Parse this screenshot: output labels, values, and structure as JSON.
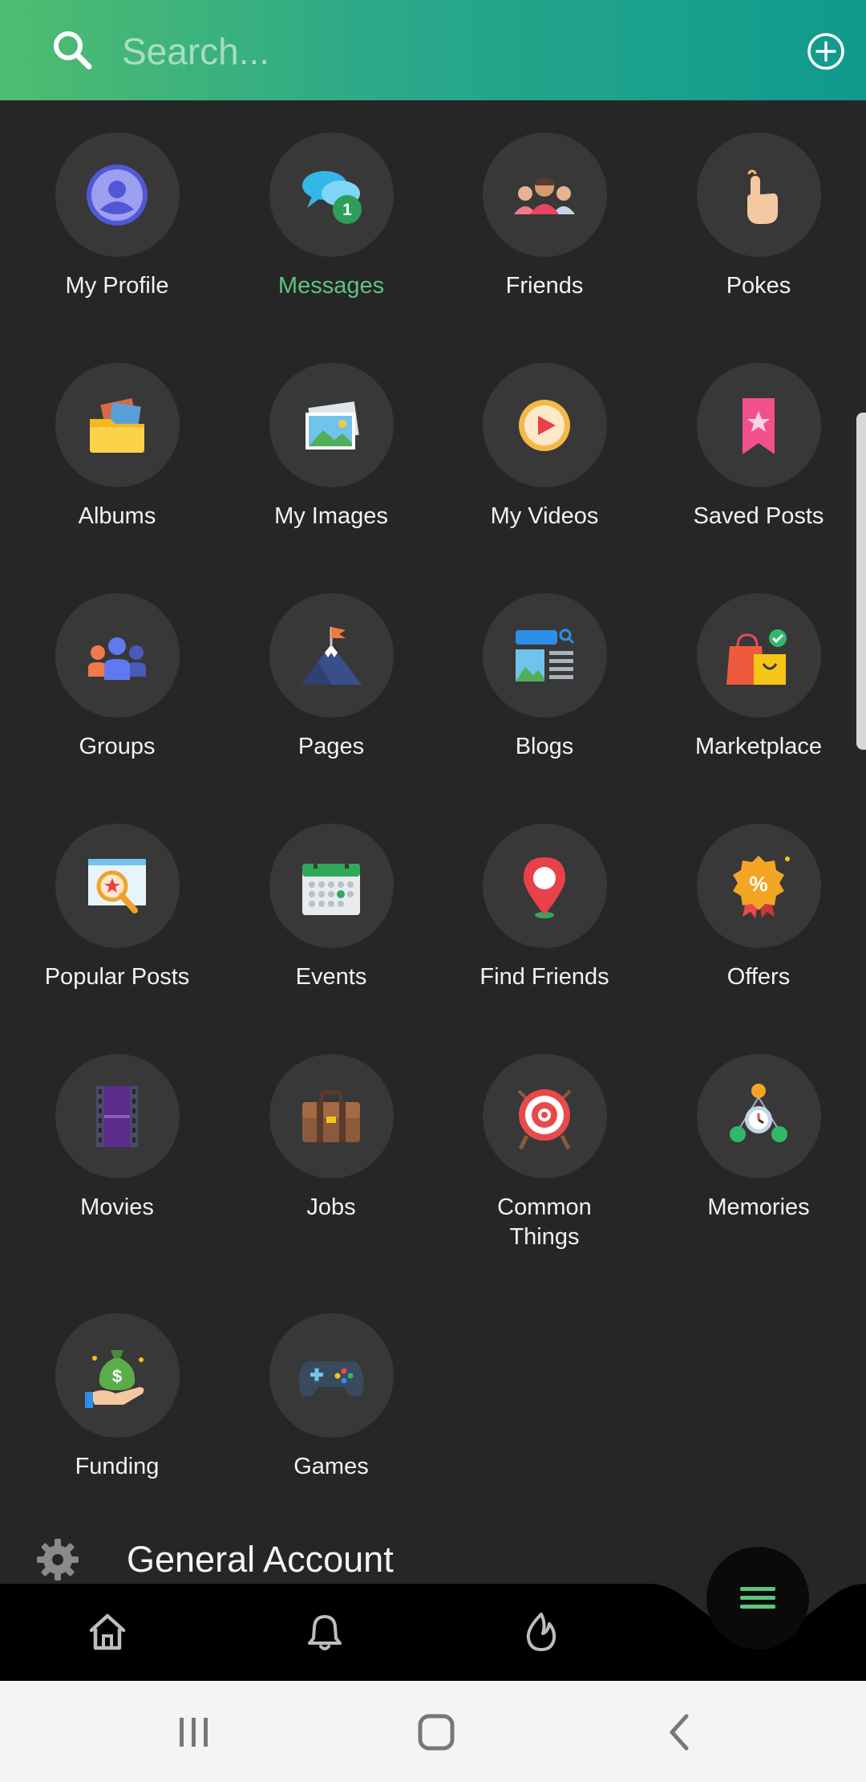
{
  "search": {
    "placeholder": "Search..."
  },
  "grid": [
    {
      "label": "My Profile",
      "icon": "profile-icon"
    },
    {
      "label": "Messages",
      "icon": "messages-icon",
      "badge": "1",
      "active": true
    },
    {
      "label": "Friends",
      "icon": "friends-icon"
    },
    {
      "label": "Pokes",
      "icon": "poke-hand-icon"
    },
    {
      "label": "Albums",
      "icon": "album-folder-icon"
    },
    {
      "label": "My Images",
      "icon": "images-icon"
    },
    {
      "label": "My Videos",
      "icon": "video-play-icon"
    },
    {
      "label": "Saved Posts",
      "icon": "bookmark-icon"
    },
    {
      "label": "Groups",
      "icon": "groups-icon"
    },
    {
      "label": "Pages",
      "icon": "flag-mountain-icon"
    },
    {
      "label": "Blogs",
      "icon": "blog-icon"
    },
    {
      "label": "Marketplace",
      "icon": "shopping-bag-icon"
    },
    {
      "label": "Popular Posts",
      "icon": "popular-search-icon"
    },
    {
      "label": "Events",
      "icon": "calendar-icon"
    },
    {
      "label": "Find Friends",
      "icon": "location-pin-icon"
    },
    {
      "label": "Offers",
      "icon": "offer-badge-icon"
    },
    {
      "label": "Movies",
      "icon": "film-strip-icon"
    },
    {
      "label": "Jobs",
      "icon": "briefcase-icon"
    },
    {
      "label": "Common Things",
      "icon": "target-icon"
    },
    {
      "label": "Memories",
      "icon": "memories-clock-icon"
    },
    {
      "label": "Funding",
      "icon": "money-bag-hand-icon"
    },
    {
      "label": "Games",
      "icon": "gamepad-icon"
    }
  ],
  "settings_section": {
    "title": "General Account",
    "icon": "gear-icon"
  },
  "bottom_nav": [
    {
      "name": "home",
      "icon": "home-icon"
    },
    {
      "name": "notifications",
      "icon": "bell-icon"
    },
    {
      "name": "trending",
      "icon": "flame-icon"
    },
    {
      "name": "menu",
      "icon": "menu-icon",
      "active": true
    }
  ],
  "colors": {
    "accent": "#5cc57d",
    "header_start": "#4fbd6f",
    "header_end": "#0f9a8e",
    "background": "#262626"
  }
}
